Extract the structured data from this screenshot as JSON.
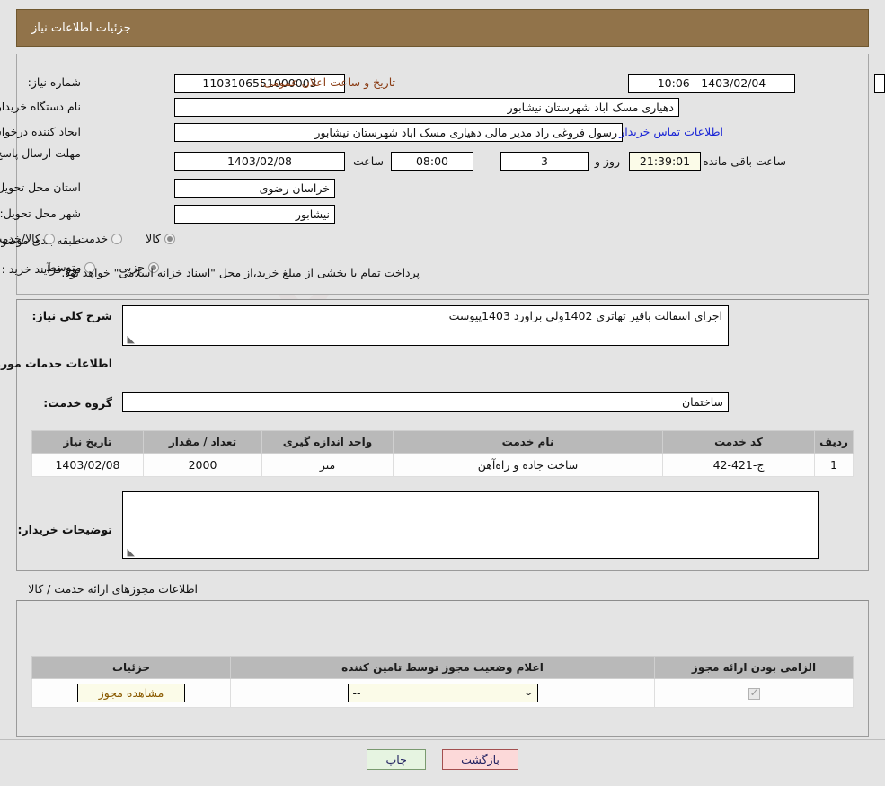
{
  "header": {
    "title": "جزئیات اطلاعات نیاز"
  },
  "top_form": {
    "need_number_label": "شماره نیاز:",
    "need_number_value": "1103106551000003",
    "announce_label": "تاریخ و ساعت اعلان عمومی:",
    "announce_value": "1403/02/04 - 10:06",
    "buyer_org_label": "نام دستگاه خریدار:",
    "buyer_org_value": "دهیاری مسک اباد شهرستان نیشابور",
    "creator_label": "ایجاد کننده درخواست:",
    "creator_value": "رسول فروغی راد مدیر مالی دهیاری مسک اباد شهرستان نیشابور",
    "contact_link": "اطلاعات تماس خریدار",
    "deadline_label": "مهلت ارسال پاسخ: تا تاریخ:",
    "deadline_date": "1403/02/08",
    "hour_label": "ساعت",
    "hour_value": "08:00",
    "days_value": "3",
    "days_and_label": "روز و",
    "countdown_value": "21:39:01",
    "remaining_label": "ساعت باقی مانده",
    "province_label": "استان محل تحویل:",
    "province_value": "خراسان رضوی",
    "city_label": "شهر محل تحویل:",
    "city_value": "نیشابور",
    "category_label": "طبقه بندی موضوعی:",
    "category_options": [
      {
        "label": "کالا",
        "selected": true
      },
      {
        "label": "خدمت",
        "selected": false
      },
      {
        "label": "کالا/خدمت",
        "selected": false
      }
    ],
    "process_label": "نوع فرآیند خرید :",
    "process_options": [
      {
        "label": "جزیی",
        "selected": true
      },
      {
        "label": "متوسط",
        "selected": false
      }
    ],
    "process_note": "پرداخت تمام یا بخشی از مبلغ خرید،از محل \"اسناد خزانه اسلامی\" خواهد بود."
  },
  "middle": {
    "summary_label": "شرح کلی نیاز:",
    "summary_value": "اجرای اسفالت باقیر تهاتری 1402ولی براورد 1403پیوست",
    "services_heading": "اطلاعات خدمات مورد نیاز",
    "service_group_label": "گروه خدمت:",
    "service_group_value": "ساختمان",
    "buyer_notes_label": "توضیحات خریدار:",
    "buyer_notes_value": ""
  },
  "services_table": {
    "columns": [
      "ردیف",
      "کد خدمت",
      "نام خدمت",
      "واحد اندازه گیری",
      "تعداد / مقدار",
      "تاریخ نیاز"
    ],
    "rows": [
      {
        "row_no": "1",
        "service_code": "ج-421-42",
        "service_name": "ساخت جاده و راه‌آهن",
        "unit": "متر",
        "quantity": "2000",
        "need_date": "1403/02/08"
      }
    ]
  },
  "permits": {
    "caption": "اطلاعات مجوزهای ارائه خدمت / کالا",
    "columns": [
      "الزامی بودن ارائه مجوز",
      "اعلام وضعیت مجوز توسط تامین کننده",
      "جزئیات"
    ],
    "rows": [
      {
        "required_checked": true,
        "status_value": "--",
        "details_button": "مشاهده مجوز"
      }
    ]
  },
  "footer": {
    "print_label": "چاپ",
    "back_label": "بازگشت"
  },
  "watermark": {
    "text": "AriaTender.net"
  },
  "colors": {
    "header_bg": "#91734a",
    "page_bg": "#e4e4e4",
    "link": "#1a25d6",
    "back_btn_bg": "#fcd9d9",
    "print_btn_bg": "#e6f4e1"
  }
}
